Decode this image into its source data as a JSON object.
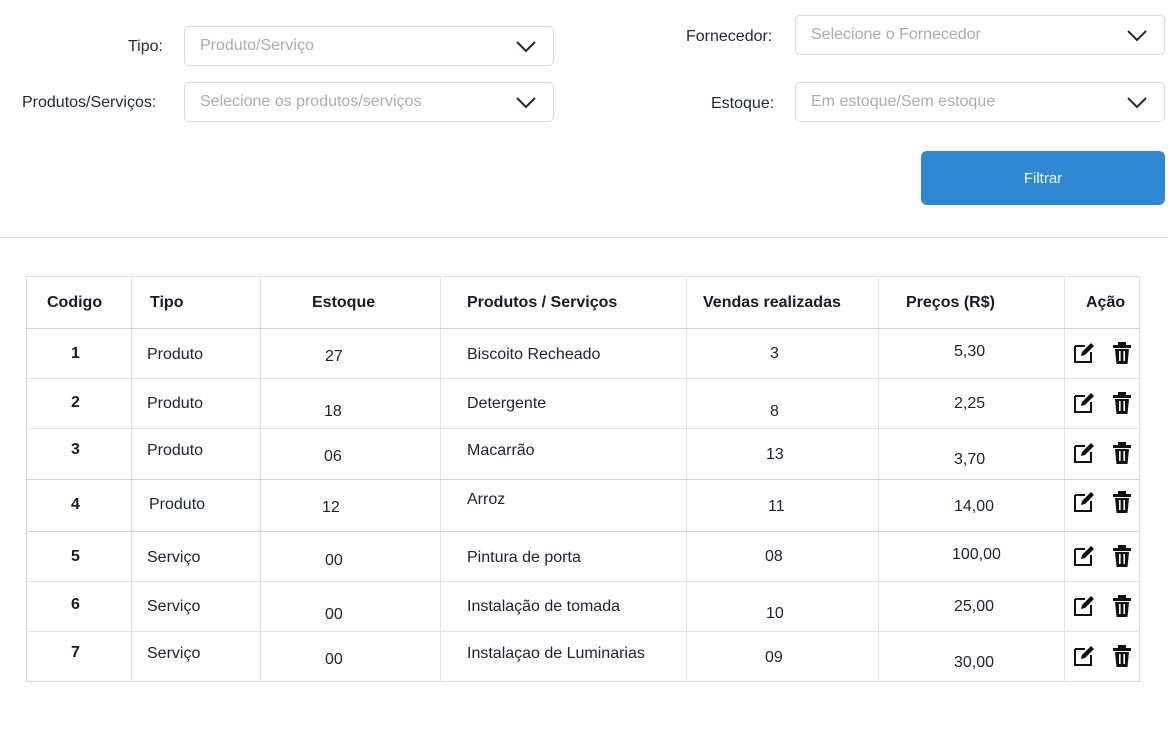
{
  "filters": {
    "tipo": {
      "label": "Tipo:",
      "placeholder": "Produto/Serviço"
    },
    "produtos": {
      "label": "Produtos/Serviços:",
      "placeholder": "Selecione os produtos/serviços"
    },
    "fornecedor": {
      "label": "Fornecedor:",
      "placeholder": "Selecione o Fornecedor"
    },
    "estoque": {
      "label": "Estoque:",
      "placeholder": "Em estoque/Sem estoque"
    },
    "button_label": "Filtrar"
  },
  "table": {
    "headers": [
      "Codigo",
      "Tipo",
      "Estoque",
      "Produtos / Serviços",
      "Vendas realizadas",
      "Preços (R$)",
      "Ação"
    ],
    "rows": [
      {
        "codigo": "1",
        "tipo": "Produto",
        "estoque": "27",
        "produto": "Biscoito Recheado",
        "vendas": "3",
        "preco": "5,30"
      },
      {
        "codigo": "2",
        "tipo": "Produto",
        "estoque": "18",
        "produto": "Detergente",
        "vendas": "8",
        "preco": "2,25"
      },
      {
        "codigo": "3",
        "tipo": "Produto",
        "estoque": "06",
        "produto": "Macarrão",
        "vendas": "13",
        "preco": "3,70"
      },
      {
        "codigo": "4",
        "tipo": "Produto",
        "estoque": "12",
        "produto": "Arroz",
        "vendas": "11",
        "preco": "14,00"
      },
      {
        "codigo": "5",
        "tipo": "Serviço",
        "estoque": "00",
        "produto": "Pintura de porta",
        "vendas": "08",
        "preco": "100,00"
      },
      {
        "codigo": "6",
        "tipo": "Serviço",
        "estoque": "00",
        "produto": "Instalação de tomada",
        "vendas": "10",
        "preco": "25,00"
      },
      {
        "codigo": "7",
        "tipo": "Serviço",
        "estoque": "00",
        "produto": "Instalaçao de Luminarias",
        "vendas": "09",
        "preco": "30,00"
      }
    ],
    "row_icons": [
      "edit-icon",
      "trash-icon"
    ]
  },
  "colors": {
    "primary": "#2f88d2",
    "border": "#d7dbe0",
    "placeholder": "#a8adb5"
  }
}
